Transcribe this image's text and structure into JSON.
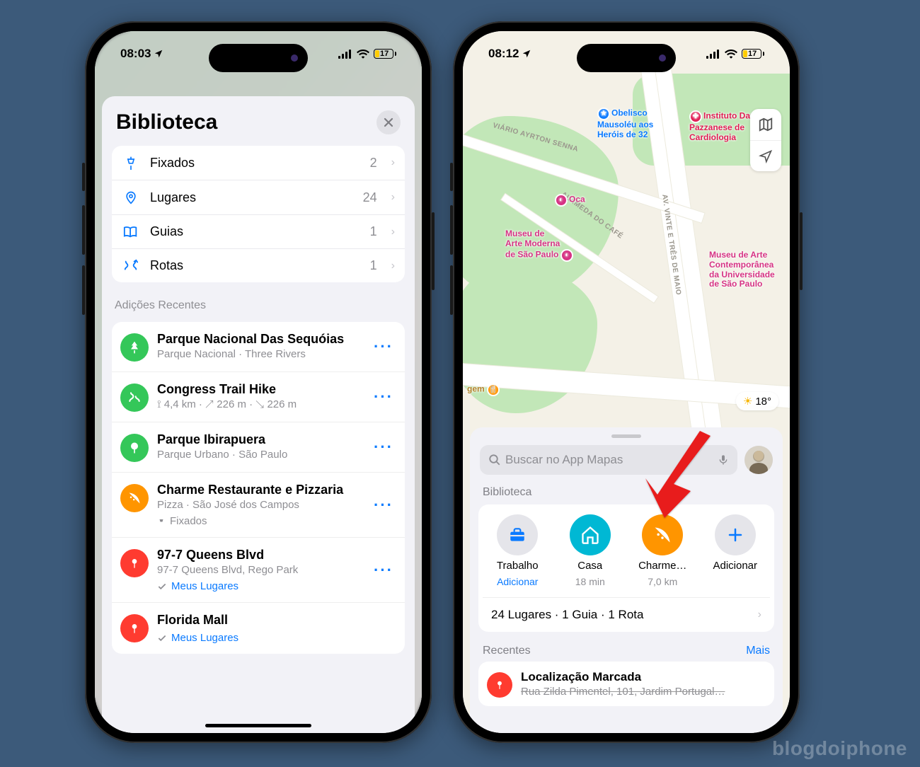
{
  "watermark": "blogdoiphone",
  "left": {
    "status": {
      "time": "08:03",
      "battery": "17"
    },
    "sheet_title": "Biblioteca",
    "categories": [
      {
        "icon": "pin",
        "label": "Fixados",
        "count": "2"
      },
      {
        "icon": "place",
        "label": "Lugares",
        "count": "24"
      },
      {
        "icon": "guide",
        "label": "Guias",
        "count": "1"
      },
      {
        "icon": "route",
        "label": "Rotas",
        "count": "1"
      }
    ],
    "recent_heading": "Adições Recentes",
    "recents": [
      {
        "color": "green",
        "icon": "tree",
        "title": "Parque Nacional Das Sequóias",
        "sub": "Parque Nacional · Three Rivers"
      },
      {
        "color": "green",
        "icon": "route",
        "title": "Congress Trail Hike",
        "sub": "⟟ 4,4 km · ↗ 226 m · ↘ 226 m"
      },
      {
        "color": "green",
        "icon": "tree",
        "title": "Parque Ibirapuera",
        "sub": "Parque Urbano · São Paulo"
      },
      {
        "color": "orange",
        "icon": "pizza",
        "title": "Charme Restaurante e Pizzaria",
        "sub": "Pizza · São José dos Campos",
        "tag": "Fixados",
        "tag_style": "gray"
      },
      {
        "color": "red",
        "icon": "pin",
        "title": "97-7 Queens Blvd",
        "sub": "97-7 Queens Blvd, Rego Park",
        "tag": "Meus Lugares",
        "tag_style": "blue"
      },
      {
        "color": "red",
        "icon": "pin",
        "title": "Florida Mall",
        "sub": "",
        "tag": "Meus Lugares",
        "tag_style": "blue"
      }
    ]
  },
  "right": {
    "status": {
      "time": "08:12",
      "battery": "17"
    },
    "pois": {
      "obelisco": "Obelisco\nMausoléu aos\nHeróis de 32",
      "dante": "Instituto Dante\nPazzanese de\nCardiologia",
      "oca": "Oca",
      "mam": "Museu de\nArte Moderna\nde São Paulo",
      "mac": "Museu de Arte\nContemporânea\nda Universidade\nde São Paulo",
      "road1": "AV. VINTE E TRÊS DE MAIO",
      "road2": "ALAMEDA DO CAFÉ",
      "road3": "VIÁRIO AYRTON SENNA",
      "gem": "gem"
    },
    "weather": "18°",
    "search_placeholder": "Buscar no App Mapas",
    "lib_heading": "Biblioteca",
    "lib_items": [
      {
        "style": "gray",
        "icon": "briefcase",
        "name": "Trabalho",
        "sub": "Adicionar",
        "sub_link": true
      },
      {
        "style": "cyan",
        "icon": "home",
        "name": "Casa",
        "sub": "18 min",
        "sub_link": false
      },
      {
        "style": "orange",
        "icon": "pizza",
        "name": "Charme…",
        "sub": "7,0 km",
        "sub_link": false
      },
      {
        "style": "plus",
        "icon": "plus",
        "name": "Adicionar",
        "sub": "",
        "sub_link": false
      }
    ],
    "lib_summary": "24 Lugares · 1 Guia · 1 Rota",
    "recents_heading": "Recentes",
    "recents_more": "Mais",
    "recent_loc": {
      "title": "Localização Marcada",
      "sub": "Rua Zilda Pimentel, 101, Jardim Portugal…"
    }
  }
}
